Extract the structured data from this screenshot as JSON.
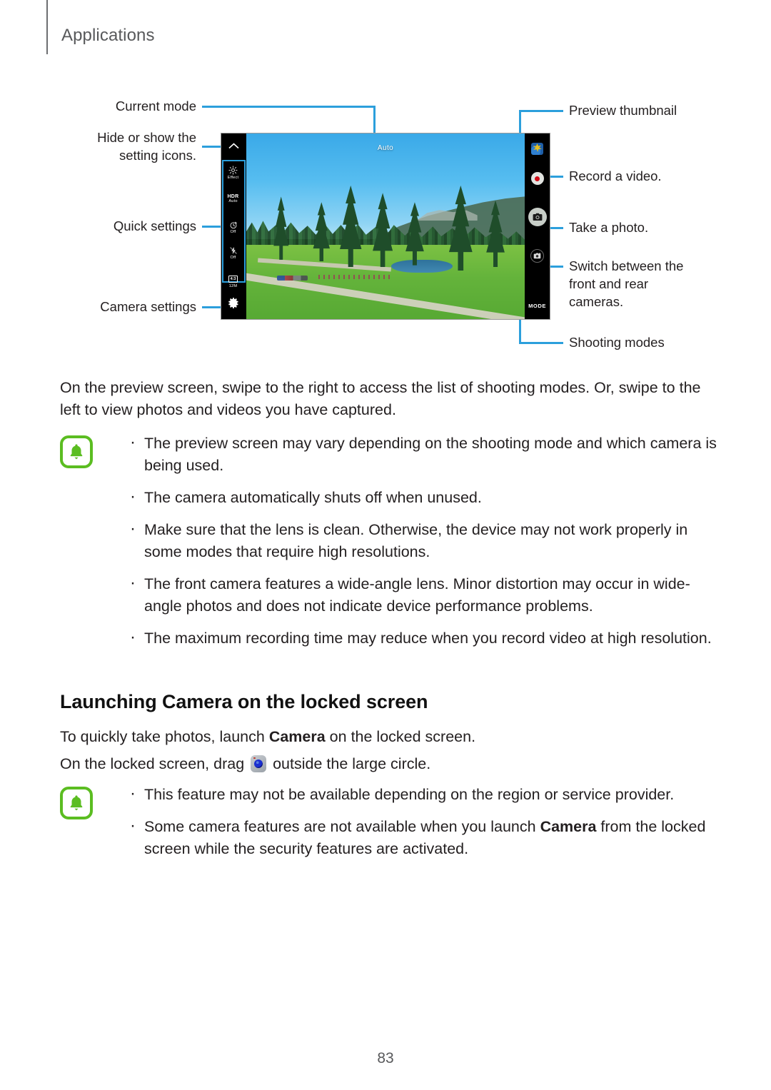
{
  "header": {
    "title": "Applications"
  },
  "diagram": {
    "labels_left": [
      {
        "name": "current-mode",
        "text": "Current mode"
      },
      {
        "name": "hide-show-setting-icons",
        "text": "Hide or show the\nsetting icons."
      },
      {
        "name": "quick-settings",
        "text": "Quick settings"
      },
      {
        "name": "camera-settings",
        "text": "Camera settings"
      }
    ],
    "labels_right": [
      {
        "name": "preview-thumbnail",
        "text": "Preview thumbnail"
      },
      {
        "name": "record-a-video",
        "text": "Record a video."
      },
      {
        "name": "take-a-photo",
        "text": "Take a photo."
      },
      {
        "name": "switch-cameras",
        "text": "Switch between the\nfront and rear\ncameras."
      },
      {
        "name": "shooting-modes",
        "text": "Shooting modes"
      }
    ],
    "screen": {
      "mode_label": "Auto",
      "mode_button_label": "MODE",
      "quick_settings": [
        {
          "icon": "effect-icon",
          "label": "Effect",
          "value": ""
        },
        {
          "icon": "hdr-icon",
          "label": "HDR",
          "value": "Auto"
        },
        {
          "icon": "timer-icon",
          "label": "",
          "value": "Off"
        },
        {
          "icon": "flash-off-icon",
          "label": "",
          "value": "Off"
        },
        {
          "icon": "aspect-ratio-icon",
          "label": "4:3",
          "value": "12M"
        }
      ]
    },
    "leader_color": "#2c9fdc"
  },
  "body": {
    "intro": "On the preview screen, swipe to the right to access the list of shooting modes. Or, swipe to the left to view photos and videos you have captured.",
    "note_one_bullets": [
      "The preview screen may vary depending on the shooting mode and which camera is being used.",
      "The camera automatically shuts off when unused.",
      "Make sure that the lens is clean. Otherwise, the device may not work properly in some modes that require high resolutions.",
      "The front camera features a wide-angle lens. Minor distortion may occur in wide-angle photos and does not indicate device performance problems.",
      "The maximum recording time may reduce when you record video at high resolution."
    ],
    "section_heading": "Launching Camera on the locked screen",
    "para_locked_1_pre": "To quickly take photos, launch ",
    "para_locked_1_bold": "Camera",
    "para_locked_1_post": " on the locked screen.",
    "para_locked_2_pre": "On the locked screen, drag ",
    "para_locked_2_post": " outside the large circle.",
    "note_two_bullets": [
      {
        "pre": "This feature may not be available depending on the region or service provider.",
        "bold": "",
        "post": ""
      },
      {
        "pre": "Some camera features are not available when you launch ",
        "bold": "Camera",
        "post": " from the locked screen while the security features are activated."
      }
    ]
  },
  "footer": {
    "page_number": "83"
  },
  "colors": {
    "accent": "#2c9fdc",
    "note_green": "#5bbd21",
    "text": "#231f20"
  }
}
